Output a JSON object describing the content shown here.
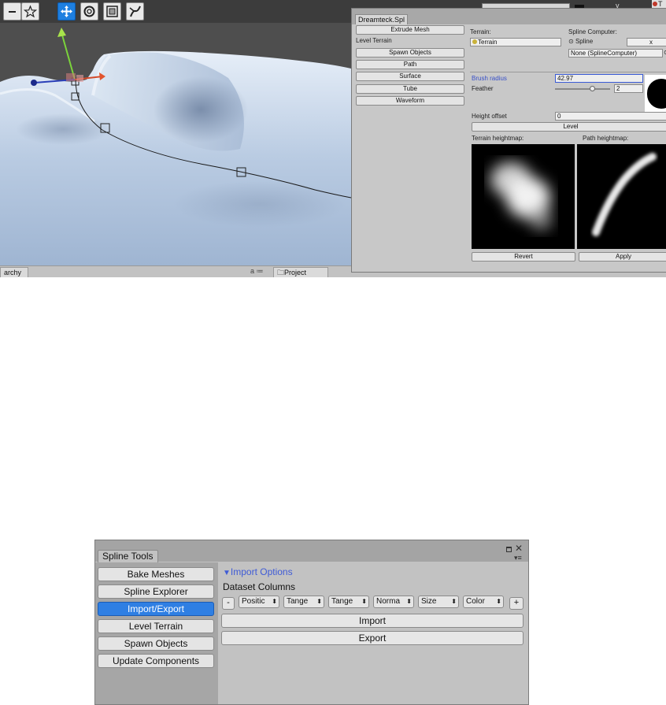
{
  "scene_editor": {
    "toolbar": {
      "icons": [
        "minus-icon",
        "star-icon",
        "move-tool-icon",
        "rotate-tool-icon",
        "scale-tool-icon",
        "spline-tool-icon"
      ],
      "axis_label": "y",
      "right_label": "T"
    },
    "hierarchy_tab": "archy",
    "project_tab": "Project",
    "lock_glyph": "a ≔"
  },
  "dreamteck_panel": {
    "tab": "Dreamteck.Spl",
    "buttons": [
      "Extrude Mesh",
      "Spawn Objects",
      "Path",
      "Surface",
      "Tube",
      "Waveform"
    ],
    "level_terrain_label": "Level Terrain",
    "terrain_label": "Terrain:",
    "terrain_value": "Terrain",
    "spline_computer_label": "Spline Computer:",
    "spline_label": "Spline",
    "spline_x": "x",
    "spline_value": "None (SplineComputer)",
    "brush_radius_label": "Brush radius",
    "brush_radius_value": "42.97",
    "feather_label": "Feather",
    "feather_value": "2",
    "feather_level": 0.7,
    "height_offset_label": "Height offset",
    "height_offset_value": "0",
    "level_button": "Level",
    "terrain_heightmap_label": "Terrain heightmap:",
    "path_heightmap_label": "Path heightmap:",
    "revert_button": "Revert",
    "apply_button": "Apply"
  },
  "spline_tools": {
    "tab": "Spline Tools",
    "sidebar": [
      {
        "label": "Bake Meshes",
        "active": false
      },
      {
        "label": "Spline Explorer",
        "active": false
      },
      {
        "label": "Import/Export",
        "active": true
      },
      {
        "label": "Level Terrain",
        "active": false
      },
      {
        "label": "Spawn Objects",
        "active": false
      },
      {
        "label": "Update Components",
        "active": false
      }
    ],
    "import_options": "Import Options",
    "dataset_columns": "Dataset Columns",
    "remove_button": "-",
    "add_button": "+",
    "columns": [
      "Positic",
      "Tange",
      "Tange",
      "Norma",
      "Size",
      "Color"
    ],
    "import_button": "Import",
    "export_button": "Export",
    "accent_color": "#2f7fe3",
    "link_color": "#3f5bd6"
  }
}
